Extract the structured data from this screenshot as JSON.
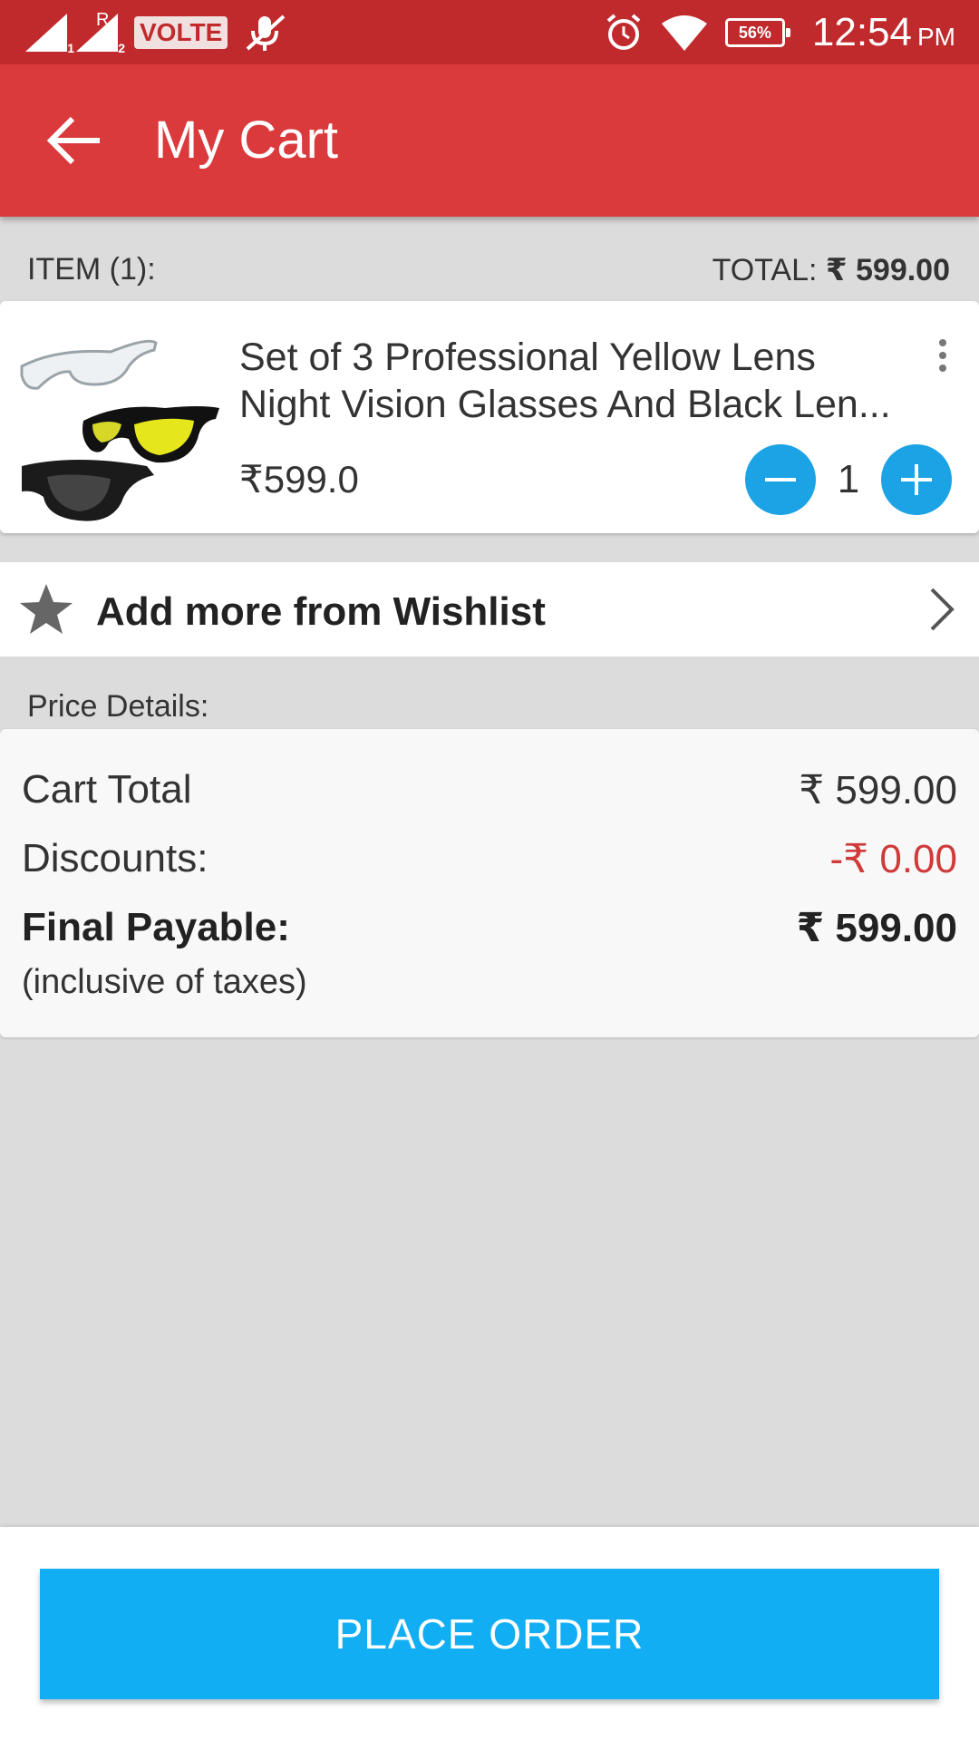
{
  "status_bar": {
    "sim1_sub": "1",
    "sim2_sub": "2",
    "roaming": "R",
    "volte": "VOLTE",
    "battery": "56%",
    "time": "12:54",
    "ampm": "PM"
  },
  "toolbar": {
    "title": "My Cart"
  },
  "summary": {
    "items": "ITEM (1):",
    "total_label": "TOTAL: ",
    "total_value": "₹ 599.00"
  },
  "cart_item": {
    "name_line1": "Set of 3 Professional Yellow Lens",
    "name_line2": "Night Vision Glasses And Black Len...",
    "price": "₹599.0",
    "quantity": "1"
  },
  "wishlist": {
    "label": "Add more from Wishlist"
  },
  "price_details": {
    "heading": "Price Details:",
    "cart_total_label": "Cart Total",
    "cart_total_value": "₹ 599.00",
    "discounts_label": "Discounts:",
    "discounts_value": "-₹ 0.00",
    "final_label": "Final Payable:",
    "final_value": "₹ 599.00",
    "inclusive_note": "(inclusive of taxes)"
  },
  "actions": {
    "place_order": "PLACE ORDER"
  },
  "colors": {
    "status_bar": "#c12a2d",
    "toolbar": "#db3a3d",
    "accent_blue": "#12aef4",
    "discount_red": "#d03a3a"
  },
  "icons": [
    "signal-icon",
    "volte-icon",
    "mic-muted-icon",
    "alarm-icon",
    "wifi-icon",
    "battery-icon",
    "back-arrow-icon",
    "more-vert-icon",
    "minus-icon",
    "plus-icon",
    "star-icon",
    "chevron-right-icon"
  ]
}
